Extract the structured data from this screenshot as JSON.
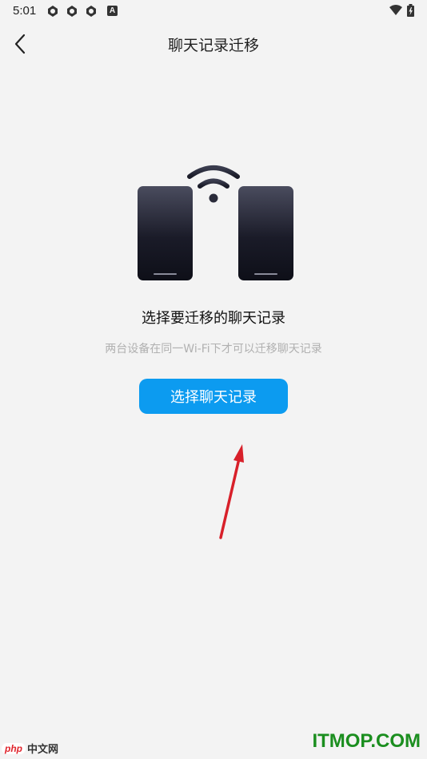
{
  "status_bar": {
    "time": "5:01",
    "left_icons": [
      "app-notification-icon",
      "app-notification-icon",
      "app-notification-icon",
      "a-badge-icon"
    ],
    "a_badge_text": "A",
    "right_icons": [
      "wifi-icon",
      "battery-icon"
    ]
  },
  "header": {
    "back_icon": "chevron-left-icon",
    "title": "聊天记录迁移"
  },
  "main": {
    "heading": "选择要迁移的聊天记录",
    "subtext": "两台设备在同一Wi-Fi下才可以迁移聊天记录",
    "button_label": "选择聊天记录"
  },
  "watermarks": {
    "left_php": "php",
    "left_cn": "中文网",
    "right": "ITMOP.COM"
  },
  "colors": {
    "background": "#f3f3f3",
    "button": "#0c9bf0",
    "arrow": "#d8202a",
    "watermark_right": "#1b8e1f"
  }
}
